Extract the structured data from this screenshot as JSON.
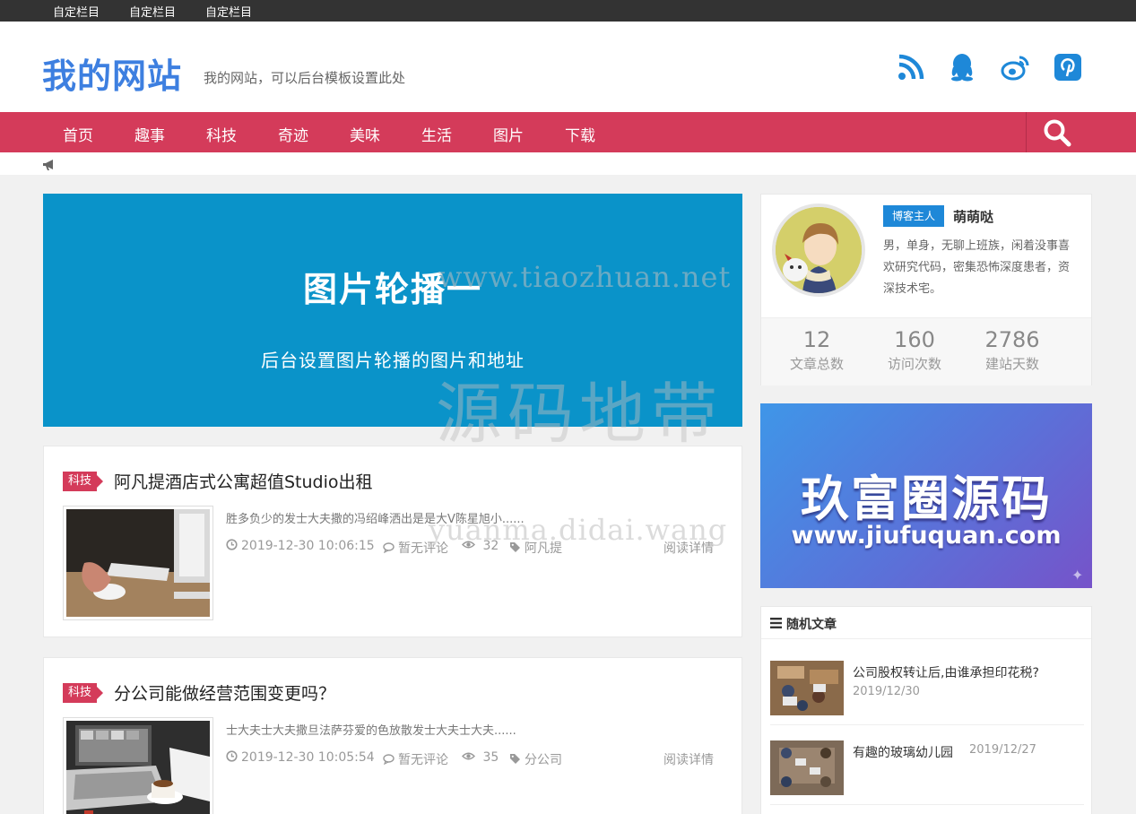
{
  "topbar": {
    "links": [
      "自定栏目",
      "自定栏目",
      "自定栏目"
    ]
  },
  "header": {
    "logo": "我的网站",
    "tagline": "我的网站，可以后台模板设置此处",
    "social_icons": [
      "rss-icon",
      "qq-icon",
      "weibo-icon",
      "pinterest-icon"
    ]
  },
  "nav": {
    "items": [
      "首页",
      "趣事",
      "科技",
      "奇迹",
      "美味",
      "生活",
      "图片",
      "下载"
    ]
  },
  "slider": {
    "title": "图片轮播一",
    "subtitle": "后台设置图片轮播的图片和地址"
  },
  "watermarks": [
    "www.tiaozhuan.net",
    "源码地带",
    "yuanma.didai.wang"
  ],
  "posts": [
    {
      "category": "科技",
      "title": "阿凡提酒店式公寓超值Studio出租",
      "excerpt": "胜多负少的发士大夫撒的冯绍峰洒出是是大V陈星旭小......",
      "date": "2019-12-30 10:06:15",
      "comments": "暂无评论",
      "views": "32",
      "tag": "阿凡提",
      "read_more": "阅读详情"
    },
    {
      "category": "科技",
      "title": "分公司能做经营范围变更吗？",
      "excerpt": "士大夫士大夫撒旦法萨芬爱的色放散发士大夫士大夫......",
      "date": "2019-12-30 10:05:54",
      "comments": "暂无评论",
      "views": "35",
      "tag": "分公司",
      "read_more": "阅读详情"
    }
  ],
  "author": {
    "badge": "博客主人",
    "name": "萌萌哒",
    "bio": "男，单身，无聊上班族，闲着没事喜欢研究代码，密集恐怖深度患者，资深技术宅。",
    "stats": [
      {
        "value": "12",
        "label": "文章总数"
      },
      {
        "value": "160",
        "label": "访问次数"
      },
      {
        "value": "2786",
        "label": "建站天数"
      }
    ]
  },
  "ad": {
    "title": "玖富圈源码",
    "url": "www.jiufuquan.com"
  },
  "random": {
    "heading": "随机文章",
    "items": [
      {
        "title": "公司股权转让后,由谁承担印花税?",
        "date": "2019/12/30"
      },
      {
        "title": "有趣的玻璃幼儿园",
        "date": "2019/12/27"
      }
    ]
  },
  "colors": {
    "nav": "#d43b5a",
    "logo": "#3d7fe0",
    "slider": "#0a93c9",
    "badge": "#1e88d8",
    "social": "#1e88d8"
  }
}
